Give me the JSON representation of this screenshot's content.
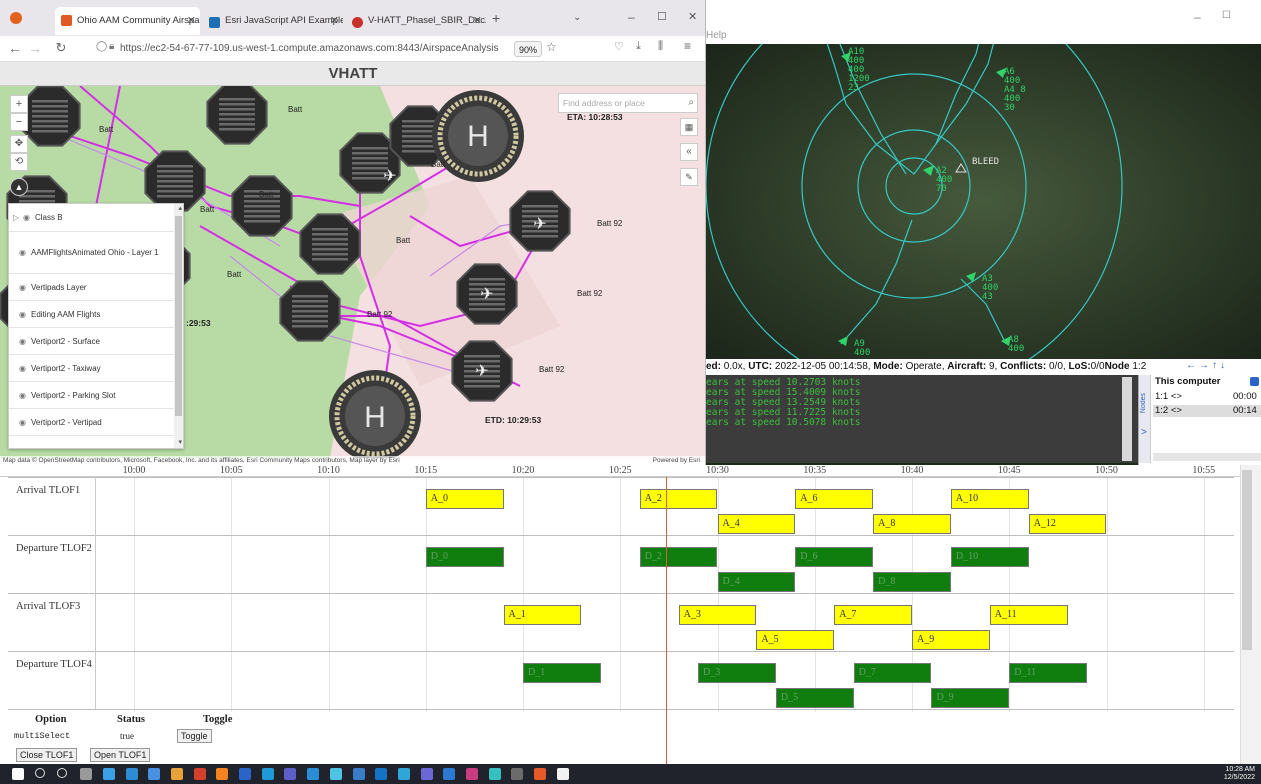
{
  "browser": {
    "tabs": [
      {
        "label": "Ohio AAM Community Airspac",
        "color": "#e05a24"
      },
      {
        "label": "Esri JavaScript API Examples: 1",
        "color": "#1c6fb5"
      },
      {
        "label": "V-HATT_Phasel_SBIR_Dec2022.p",
        "color": "#c9302c"
      }
    ],
    "url": "https://ec2-54-67-77-109.us-west-1.compute.amazonaws.com:8443/AirspaceAnalysis",
    "zoom": "90%",
    "app_title": "VHATT"
  },
  "map": {
    "search_placeholder": "Find address or place",
    "eta": "ETA: 10:28:53",
    "etd": "ETD: 10:29:53",
    "partial_time": ":29:53",
    "labels": [
      "Batt",
      "Batt",
      "Batt",
      "Batt",
      "Batt",
      "Batt",
      "Batt"
    ],
    "labels92": [
      "Batt 92",
      "Batt 92",
      "Batt 92",
      "Batt 92"
    ],
    "attribution": "Map data © OpenStreetMap contributors, Microsoft, Facebook, Inc. and its affiliates, Esri Community Maps contributors, Map layer by Esri",
    "powered_by": "Powered by Esri",
    "layers": [
      "Class B",
      "AAMFlightsAnimated Ohio - Layer 1",
      "Vertipads Layer",
      "Editing AAM Flights",
      "Vertiport2 - Surface",
      "Vertiport2 - Taxiway",
      "Vertiport2 - Parking Slot",
      "Vertiport2 - Vertipad"
    ]
  },
  "radar": {
    "menu_help": "Help",
    "bleed_label": "BLEED",
    "aircraft": [
      {
        "id": "A10",
        "lines": "A10\n400\n400\n1200\n23"
      },
      {
        "id": "A6",
        "lines": "A6\n400\nA4 8\n400\n30"
      },
      {
        "id": "A2",
        "lines": "A2\n400\n70"
      },
      {
        "id": "A3",
        "lines": "A3\n400\n43"
      },
      {
        "id": "A9",
        "lines": "A9\n400"
      },
      {
        "id": "A8",
        "lines": "A8\n400"
      }
    ],
    "status": {
      "speed_label": "ed:",
      "speed": "0.0x,",
      "utc_label": "UTC:",
      "utc": "2022-12-05 00:14:58,",
      "mode_label": "Mode:",
      "mode": "Operate,",
      "aircraft_label": "Aircraft:",
      "aircraft": "9,",
      "conflicts_label": "Conflicts:",
      "conflicts": "0/0,",
      "los_label": "LoS:",
      "los": "0/0",
      "node_label": "Node",
      "node": "1:2"
    },
    "console_lines": [
      "ears at speed 10.2703 knots",
      "ears at speed 15.4009 knots",
      "ears at speed 13.2549 knots",
      "ears at speed 11.7225 knots",
      "ears at speed 10.5078 knots"
    ],
    "nodes": {
      "side_label": "Nodes",
      "header": "This computer",
      "rows": [
        {
          "name": "1:1 <>",
          "time": "00:00"
        },
        {
          "name": "1:2 <>",
          "time": "00:14"
        }
      ]
    }
  },
  "gantt": {
    "ticks": [
      "10:00",
      "10:05",
      "10:10",
      "10:15",
      "10:20",
      "10:25",
      "10:30",
      "10:35",
      "10:40",
      "10:45",
      "10:50",
      "10:55"
    ],
    "rows": [
      {
        "label": "Arrival TLOF1",
        "kind": "a",
        "top_bars": [
          "A_0",
          "A_2",
          "A_6",
          "A_10"
        ],
        "bottom_bars": [
          "A_4",
          "A_8",
          "A_12"
        ]
      },
      {
        "label": "Departure TLOF2",
        "kind": "d",
        "top_bars": [
          "D_0",
          "D_2",
          "D_6",
          "D_10"
        ],
        "bottom_bars": [
          "D_4",
          "D_8"
        ]
      },
      {
        "label": "Arrival TLOF3",
        "kind": "a",
        "top_bars": [
          "A_1",
          "A_3",
          "A_7",
          "A_11"
        ],
        "bottom_bars": [
          "A_5",
          "A_9"
        ]
      },
      {
        "label": "Departure TLOF4",
        "kind": "d",
        "top_bars": [
          "D_1",
          "D_3",
          "D_7",
          "D_11"
        ],
        "bottom_bars": [
          "D_5",
          "D_9"
        ]
      }
    ],
    "bar_times": {
      "A_0": "10:15",
      "A_2": "10:26",
      "A_6": "10:34",
      "A_10": "10:42",
      "A_4": "10:30",
      "A_8": "10:38",
      "A_12": "10:46",
      "D_0": "10:15",
      "D_2": "10:26",
      "D_6": "10:34",
      "D_10": "10:42",
      "D_4": "10:30",
      "D_8": "10:38",
      "A_1": "10:19",
      "A_3": "10:28",
      "A_7": "10:36",
      "A_11": "10:44",
      "A_5": "10:32",
      "A_9": "10:40",
      "D_1": "10:20",
      "D_3": "10:29",
      "D_7": "10:37",
      "D_11": "10:45",
      "D_5": "10:33",
      "D_9": "10:41"
    },
    "controls": {
      "option_header": "Option",
      "status_header": "Status",
      "toggle_header": "Toggle",
      "option_name": "multiSelect",
      "option_value": "true",
      "toggle_button": "Toggle",
      "close_button": "Close TLOF1",
      "open_button": "Open TLOF1"
    }
  },
  "taskbar": {
    "time": "10:28 AM",
    "date": "12/5/2022"
  }
}
